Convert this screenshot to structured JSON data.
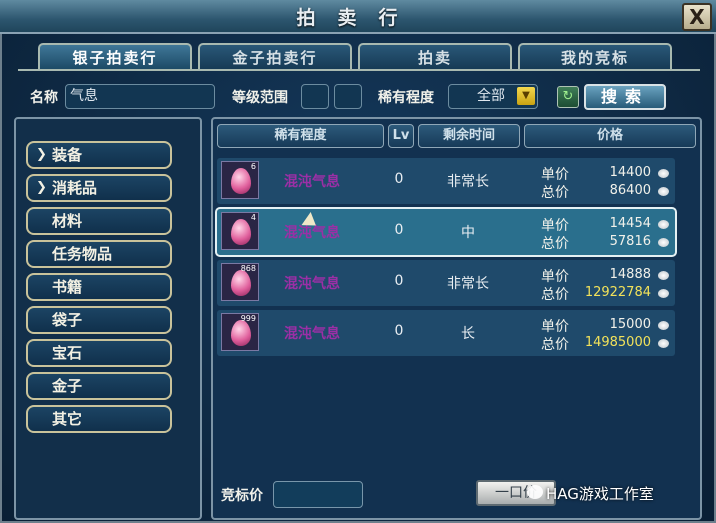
{
  "window": {
    "title": "拍卖行",
    "close_label": "X"
  },
  "tabs": [
    {
      "label": "银子拍卖行",
      "active": true
    },
    {
      "label": "金子拍卖行",
      "active": false
    },
    {
      "label": "拍卖",
      "active": false
    },
    {
      "label": "我的竞标",
      "active": false
    }
  ],
  "filters": {
    "name_label": "名称",
    "name_value": "气息",
    "level_label": "等级范围",
    "level_min": "",
    "level_max": "",
    "rarity_label": "稀有程度",
    "rarity_value": "全部",
    "search_label": "搜索"
  },
  "categories": [
    {
      "label": "装备",
      "expandable": true
    },
    {
      "label": "消耗品",
      "expandable": true
    },
    {
      "label": "材料",
      "expandable": false
    },
    {
      "label": "任务物品",
      "expandable": false
    },
    {
      "label": "书籍",
      "expandable": false
    },
    {
      "label": "袋子",
      "expandable": false
    },
    {
      "label": "宝石",
      "expandable": false
    },
    {
      "label": "金子",
      "expandable": false
    },
    {
      "label": "其它",
      "expandable": false
    }
  ],
  "table": {
    "headers": {
      "rarity": "稀有程度",
      "lv": "Lv",
      "time": "剩余时间",
      "price": "价格"
    },
    "unit_label": "单价",
    "total_label": "总价",
    "rows": [
      {
        "stack": "6",
        "name": "混沌气息",
        "lv": "0",
        "time": "非常长",
        "unit": "14400",
        "total": "86400",
        "total_gold": false,
        "selected": false
      },
      {
        "stack": "4",
        "name": "混沌气息",
        "lv": "0",
        "time": "中",
        "unit": "14454",
        "total": "57816",
        "total_gold": false,
        "selected": true
      },
      {
        "stack": "868",
        "name": "混沌气息",
        "lv": "0",
        "time": "非常长",
        "unit": "14888",
        "total": "12922784",
        "total_gold": true,
        "selected": false
      },
      {
        "stack": "999",
        "name": "混沌气息",
        "lv": "0",
        "time": "长",
        "unit": "15000",
        "total": "14985000",
        "total_gold": true,
        "selected": false
      }
    ]
  },
  "footer": {
    "bid_label": "竞标价",
    "bid_value": "",
    "buyout_label": "一口价",
    "watermark": "HAG游戏工作室"
  },
  "colors": {
    "item_name": "#9b2fa6",
    "gold_text": "#f2e25a",
    "panel": "#123150"
  }
}
